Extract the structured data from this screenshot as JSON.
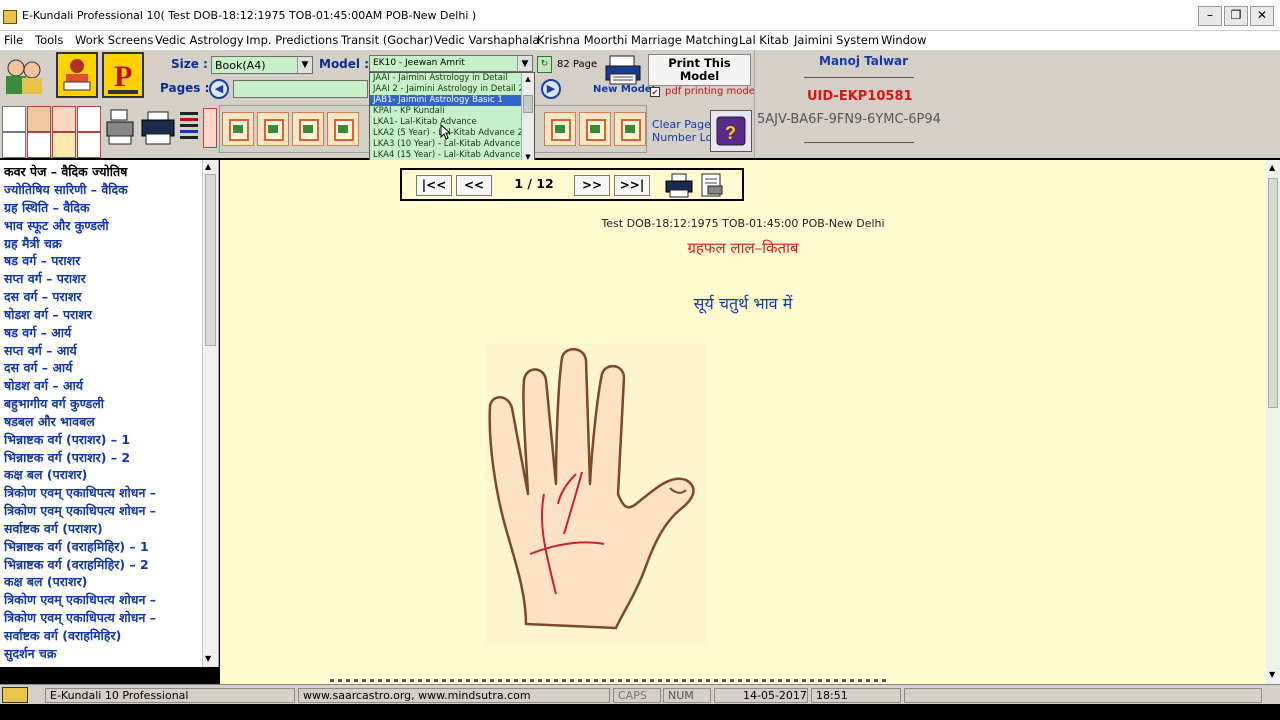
{
  "window": {
    "title": "E-Kundali Professional 10( Test DOB-18:12:1975 TOB-01:45:00AM POB-New Delhi )",
    "buttons": [
      "–",
      "❐",
      "✕"
    ]
  },
  "menu": [
    "File",
    "Tools",
    "Work Screens",
    "Vedic Astrology",
    "Imp. Predictions",
    "Transit (Gochar)",
    "Vedic Varshaphala",
    "Krishna Moorthi",
    "Marriage Matching",
    "Lal Kitab",
    "Jaimini System",
    "Window"
  ],
  "toolbar": {
    "size_label": "Size :",
    "size_value": "Book(A4)",
    "model_label": "Model :",
    "model_value": "EK10 - Jeewan Amrit",
    "page_count": "82 Page",
    "new_model": "New Model",
    "print_model": "Print This Model",
    "pdf_printing": "pdf printing mode",
    "pages_label": "Pages :",
    "clear_page": "Clear Page",
    "number_log": "Number Log",
    "user_name": "Manoj Talwar",
    "uid": "UID-EKP10581",
    "key": "5AJV-BA6F-9FN9-6YMC-6P94"
  },
  "model_options": [
    "JAAI - Jaimini Astrology in Detail",
    "JAAI 2 - Jaimini Astrology in Detail 2",
    "JAB1- Jaimini Astrology Basic 1",
    "KPAI - KP Kundali",
    "LKA1- Lal-Kitab Advance",
    "LKA2 (5 Year) - Lal-Kitab Advance 2",
    "LKA3 (10 Year) - Lal-Kitab Advance 3",
    "LKA4 (15 Year) - Lal-Kitab Advance 4"
  ],
  "sidebar": [
    "कवर पेज – वैदिक ज्योतिष",
    "ज्योतिषिय सारिणी – वैदिक",
    "ग्रह स्थिति – वैदिक",
    "भाव स्फूट और कुण्डली",
    "ग्रह मैत्री चक्र",
    "षड वर्ग – पराशर",
    "सप्त वर्ग – पराशर",
    "दस वर्ग – पराशर",
    "षोडश वर्ग – पराशर",
    "षड वर्ग – आर्य",
    "सप्त वर्ग – आर्य",
    "दस वर्ग – आर्य",
    "षोडश वर्ग – आर्य",
    "बहुभागीय वर्ग कुण्डली",
    "षडबल और भावबल",
    "भिन्नाष्टक वर्ग (पराशर) – 1",
    "भिन्नाष्टक वर्ग (पराशर) – 2",
    "कक्ष बल (पराशर)",
    "त्रिकोण एवम् एकाधिपत्य शोधन –",
    "त्रिकोण एवम् एकाधिपत्य शोधन –",
    "सर्वाष्टक वर्ग (पराशर)",
    "भिन्नाष्टक वर्ग (वराहमिहिर) – 1",
    "भिन्नाष्टक वर्ग (वराहमिहिर) – 2",
    "कक्ष बल (पराशर)",
    "त्रिकोण एवम् एकाधिपत्य शोधन –",
    "त्रिकोण एवम् एकाधिपत्य शोधन –",
    "सर्वाष्टक वर्ग (वराहमिहिर)",
    "सुदर्शन चक्र"
  ],
  "nav": {
    "first": "|<<",
    "prev": "<<",
    "page": "1 / 12",
    "next": ">>",
    "last": ">>|"
  },
  "page": {
    "subject": "Test DOB-18:12:1975 TOB-01:45:00 POB-New Delhi",
    "heading": "ग्रहफल लाल–किताब",
    "subheading": "सूर्य चतुर्थ भाव में"
  },
  "status": {
    "app": "E-Kundali 10 Professional",
    "site": "www.saarcastro.org, www.mindsutra.com",
    "caps": "CAPS",
    "num": "NUM",
    "date": "14-05-2017",
    "time": "18:51"
  },
  "colors": {
    "toolbar_bg": "#d4d0c8",
    "select_bg": "#c8f0c8",
    "content_bg": "#fffad0",
    "sidebar_text": "#1538a8",
    "heading_red": "#d42020",
    "uid_red": "#e01010",
    "highlight": "#3165c8"
  }
}
